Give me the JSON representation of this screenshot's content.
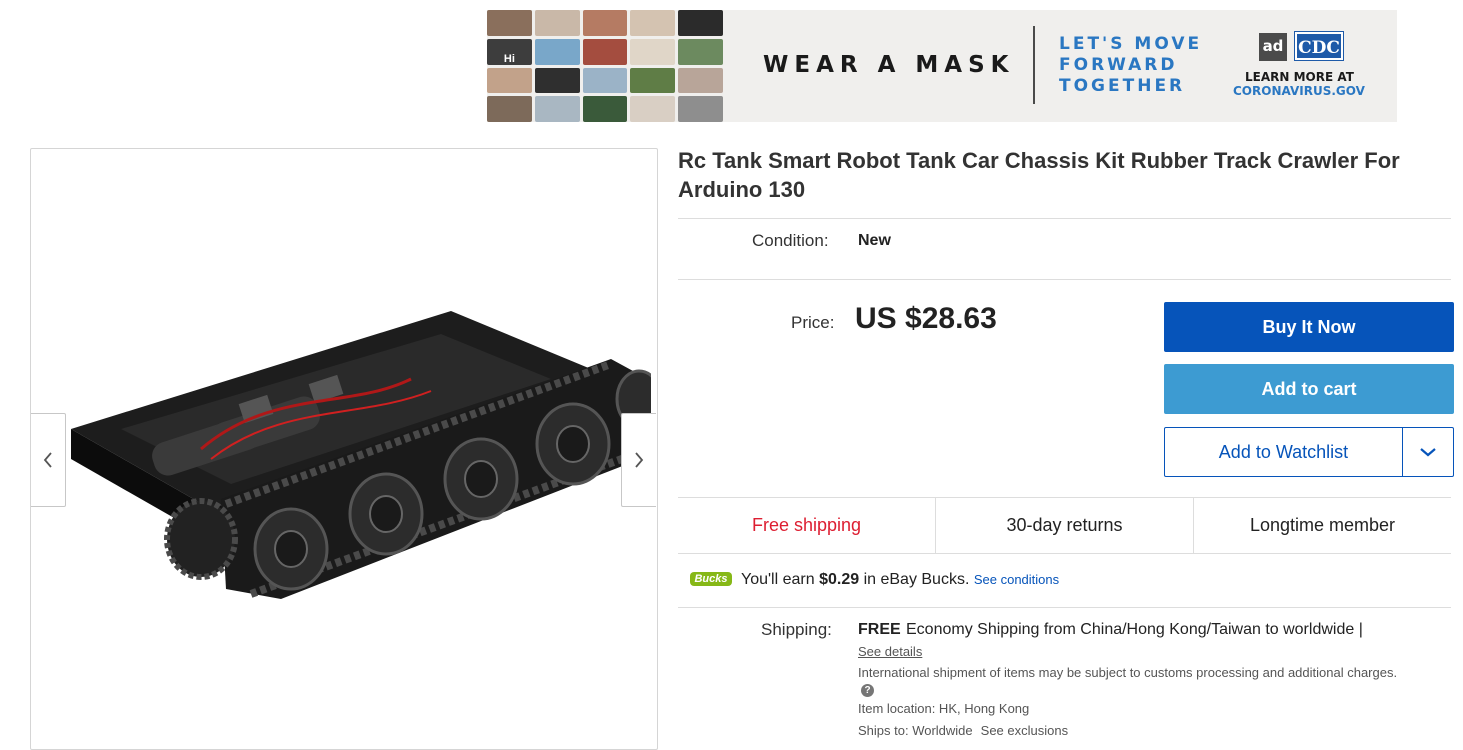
{
  "ad_banner": {
    "collage_badge": "Hi",
    "headline": "WEAR A MASK",
    "tagline_lines": [
      "LET'S MOVE",
      "FORWARD",
      "TOGETHER"
    ],
    "logo_ad": "ad",
    "logo_cdc": "CDC",
    "learn_more": "LEARN MORE AT",
    "url": "CORONAVIRUS.GOV"
  },
  "gallery": {
    "prev_icon": "chevron-left-icon",
    "next_icon": "chevron-right-icon"
  },
  "listing": {
    "title": "Rc Tank Smart Robot Tank Car Chassis Kit Rubber Track Crawler For Arduino 130",
    "condition_label": "Condition:",
    "condition_value": "New",
    "price_label": "Price:",
    "price_value": "US $28.63"
  },
  "actions": {
    "buy_now": "Buy It Now",
    "add_to_cart": "Add to cart",
    "add_to_watchlist": "Add to Watchlist",
    "watchlist_dropdown_icon": "chevron-down-icon"
  },
  "features": [
    "Free shipping",
    "30-day returns",
    "Longtime member"
  ],
  "bucks": {
    "logo": "Bucks",
    "prefix": "You'll earn ",
    "amount": "$0.29",
    "suffix": " in eBay Bucks.",
    "link": "See conditions"
  },
  "shipping": {
    "label": "Shipping:",
    "cost": "FREE",
    "method": "Economy Shipping from China/Hong Kong/Taiwan to worldwide |",
    "details_link": "See details",
    "intl_note": "International shipment of items may be subject to customs processing and additional charges.",
    "help_icon": "?",
    "item_location": "Item location:  HK, Hong Kong",
    "ships_to": "Ships to:  Worldwide",
    "exclusions_link": "See exclusions"
  },
  "colors": {
    "buy_now_bg": "#0654ba",
    "add_to_cart_bg": "#3d9bd2",
    "free_shipping": "#dd1e31",
    "bucks_green": "#86b817",
    "banner_blue": "#2a77c2"
  }
}
